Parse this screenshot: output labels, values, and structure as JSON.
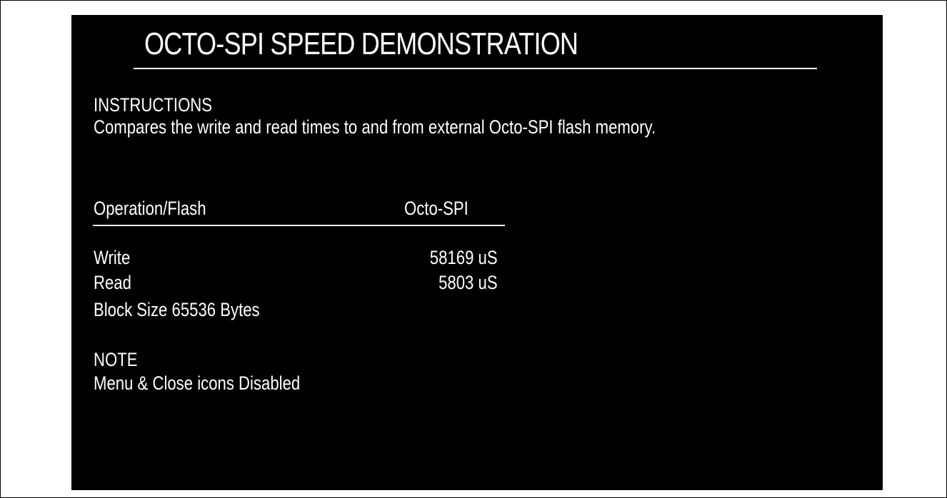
{
  "title": "OCTO-SPI SPEED DEMONSTRATION",
  "instructions": {
    "heading": "INSTRUCTIONS",
    "text": "Compares the write and read times to and from external Octo-SPI flash memory."
  },
  "table": {
    "header_operation": "Operation/Flash",
    "header_flash": "Octo-SPI",
    "rows": [
      {
        "label": "Write",
        "value": "58169 uS"
      },
      {
        "label": "Read",
        "value": "5803 uS"
      }
    ],
    "block_size": "Block Size  65536 Bytes"
  },
  "note": {
    "heading": "NOTE",
    "text": "Menu & Close icons Disabled"
  },
  "colors": {
    "screen_bg": "#000000",
    "text": "#ffffff",
    "page_bg": "#ffffff"
  }
}
